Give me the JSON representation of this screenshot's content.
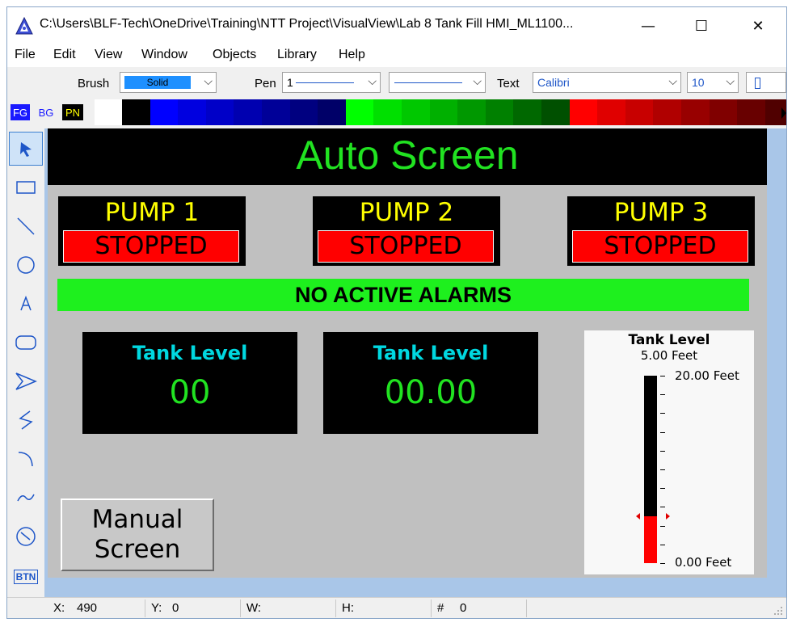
{
  "window": {
    "title": "C:\\Users\\BLF-Tech\\OneDrive\\Training\\NTT Project\\VisualView\\Lab 8 Tank Fill HMI_ML1100...",
    "minimize": "—",
    "maximize": "☐",
    "close": "✕"
  },
  "menu": [
    "File",
    "Edit",
    "View",
    "Window",
    "Objects",
    "Library",
    "Help"
  ],
  "toolbar": {
    "brush_label": "Brush",
    "brush_value": "Solid",
    "pen_label": "Pen",
    "pen_value": "1",
    "text_label": "Text",
    "font_value": "Calibri",
    "size_value": "10"
  },
  "palette": {
    "fg_label": "FG",
    "bg_label": "BG",
    "pn_label": "PN",
    "colors": [
      "#ffffff",
      "#000000",
      "#0000ff",
      "#0000e0",
      "#0000c8",
      "#0000b0",
      "#000098",
      "#000080",
      "#000068",
      "#00ff00",
      "#00e000",
      "#00c800",
      "#00b000",
      "#009800",
      "#008000",
      "#006800",
      "#005000",
      "#ff0000",
      "#e00000",
      "#c80000",
      "#b00000",
      "#980000",
      "#800000",
      "#680000",
      "#500000"
    ]
  },
  "tools": [
    "pointer-tool",
    "rectangle-tool",
    "line-tool",
    "ellipse-tool",
    "text-tool",
    "rounded-rect-tool",
    "polygon-tool",
    "polyline-tool",
    "arc-tool",
    "curve-tool",
    "gauge-tool",
    "button-tool"
  ],
  "tools_btn_label": "BTN",
  "hmi": {
    "title": "Auto Screen",
    "pumps": [
      {
        "name": "PUMP 1",
        "status": "STOPPED"
      },
      {
        "name": "PUMP 2",
        "status": "STOPPED"
      },
      {
        "name": "PUMP 3",
        "status": "STOPPED"
      }
    ],
    "alarm": "NO ACTIVE ALARMS",
    "levels": [
      {
        "title": "Tank Level",
        "value": "00"
      },
      {
        "title": "Tank Level",
        "value": "00.00"
      }
    ],
    "gauge": {
      "title": "Tank Level",
      "value_text": "5.00 Feet",
      "max_text": "20.00 Feet",
      "min_text": "0.00 Feet",
      "value": 5.0,
      "max": 20.0
    },
    "manual_button": [
      "Manual",
      "Screen"
    ]
  },
  "colors": {
    "header_text": "#21e221",
    "pump_name": "#ffff00",
    "pump_stopped_bg": "#ff0000",
    "alarm_ok_bg": "#1ef01e",
    "level_title": "#00d8e0",
    "level_value": "#21e221"
  },
  "status": {
    "x_label": "X:",
    "x_value": "490",
    "y_label": "Y:",
    "y_value": "0",
    "w_label": "W:",
    "h_label": "H:",
    "n_label": "#",
    "n_value": "0"
  }
}
